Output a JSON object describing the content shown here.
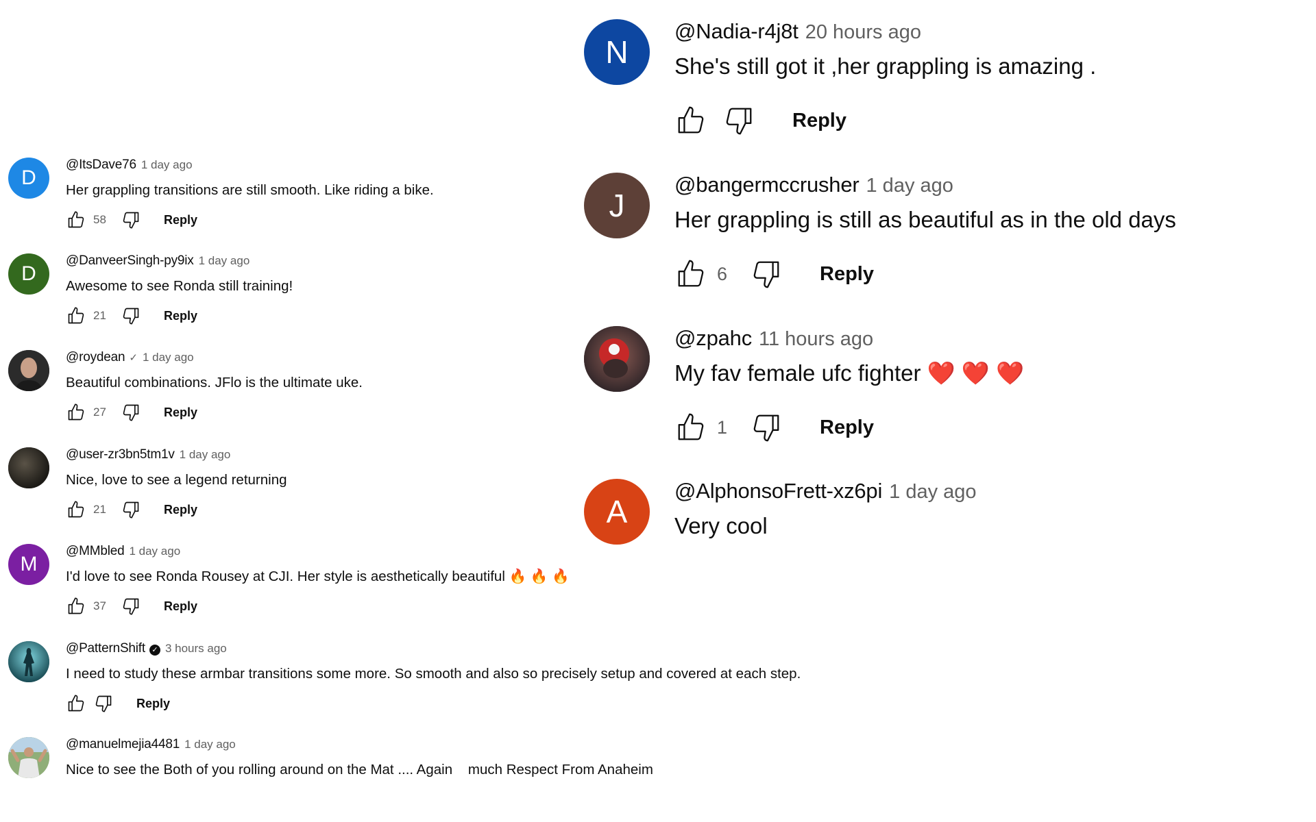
{
  "left_comments": [
    {
      "author": "@ItsDave76",
      "time": "1 day ago",
      "text": "Her grappling transitions are still smooth. Like riding a bike.",
      "likes": "58",
      "reply": "Reply",
      "avatar_letter": "D",
      "avatar_color": "#1e88e5"
    },
    {
      "author": "@DanveerSingh-py9ix",
      "time": "1 day ago",
      "text": "Awesome to see Ronda still training!",
      "likes": "21",
      "reply": "Reply",
      "avatar_letter": "D",
      "avatar_color": "#33691e"
    },
    {
      "author": "@roydean",
      "badge": "✓",
      "time": "1 day ago",
      "text": "Beautiful combinations.  JFlo is the ultimate uke.",
      "likes": "27",
      "reply": "Reply",
      "avatar_letter": "",
      "avatar_color": "#3a3a3a"
    },
    {
      "author": "@user-zr3bn5tm1v",
      "time": "1 day ago",
      "text": "Nice, love to see a legend returning",
      "likes": "21",
      "reply": "Reply",
      "avatar_letter": "",
      "avatar_color": "#2e2b25"
    },
    {
      "author": "@MMbled",
      "time": "1 day ago",
      "text": "I'd love to see Ronda Rousey at CJI. Her style is aesthetically beautiful",
      "emoji": "🔥 🔥 🔥",
      "likes": "37",
      "reply": "Reply",
      "avatar_letter": "M",
      "avatar_color": "#7b1fa2"
    },
    {
      "author": "@PatternShift",
      "badge": "✓",
      "time": "3 hours ago",
      "text": "I need to study these armbar transitions some more. So smooth and also so precisely setup and covered at each step.",
      "likes": "",
      "reply": "Reply",
      "avatar_letter": "",
      "avatar_color": "#2a6f7a"
    },
    {
      "author": "@manuelmejia4481",
      "time": "1 day ago",
      "text": "Nice to see the Both of you rolling around on the Mat .... Again    much Respect From Anaheim",
      "likes": "",
      "reply": "",
      "avatar_letter": "",
      "avatar_color": "#6d8a5a"
    }
  ],
  "right_comments": [
    {
      "author": "@Nadia-r4j8t",
      "time": "20 hours ago",
      "text": "She's still got it ,her grappling is amazing .",
      "likes": "",
      "reply": "Reply",
      "avatar_letter": "N",
      "avatar_color": "#0d47a1"
    },
    {
      "author": "@bangermccrusher",
      "time": "1 day ago",
      "text": "Her grappling is still as beautiful as in the old days",
      "likes": "6",
      "reply": "Reply",
      "avatar_letter": "J",
      "avatar_color": "#5d4037"
    },
    {
      "author": "@zpahc",
      "time": "11 hours ago",
      "text": "My fav female ufc fighter",
      "emoji": "❤️ ❤️ ❤️",
      "likes": "1",
      "reply": "Reply",
      "avatar_letter": "",
      "avatar_color": "#5a3d3a"
    },
    {
      "author": "@AlphonsoFrett-xz6pi",
      "time": "1 day ago",
      "text": "Very cool",
      "likes": "",
      "reply": "",
      "avatar_letter": "A",
      "avatar_color": "#d84315"
    }
  ],
  "icons": {
    "like": "thumb-up-icon",
    "dislike": "thumb-down-icon",
    "verified": "verified-check-icon"
  }
}
